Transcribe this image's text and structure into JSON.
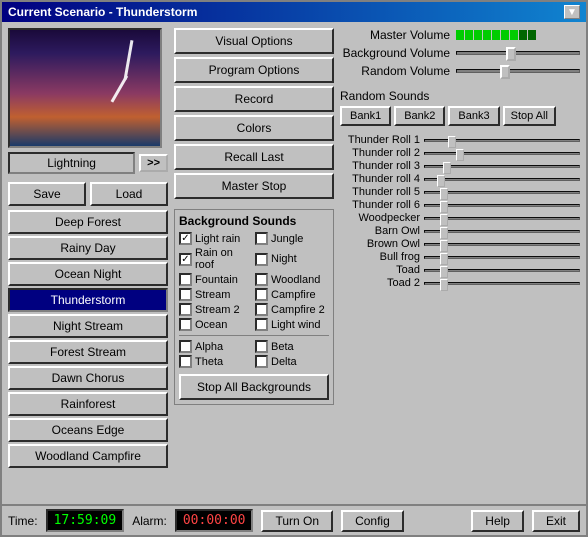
{
  "window": {
    "title": "Current Scenario - Thunderstorm",
    "minimize_btn": "▼"
  },
  "preview": {
    "label": "Lightning",
    "nav_btn": ">>"
  },
  "left_panel": {
    "save": "Save",
    "load": "Load",
    "scenarios": [
      {
        "label": "Deep Forest",
        "active": false
      },
      {
        "label": "Rainy Day",
        "active": false
      },
      {
        "label": "Ocean Night",
        "active": false
      },
      {
        "label": "Thunderstorm",
        "active": true
      },
      {
        "label": "Night Stream",
        "active": false
      },
      {
        "label": "Forest Stream",
        "active": false
      },
      {
        "label": "Dawn Chorus",
        "active": false
      },
      {
        "label": "Rainforest",
        "active": false
      },
      {
        "label": "Oceans Edge",
        "active": false
      },
      {
        "label": "Woodland Campfire",
        "active": false
      }
    ]
  },
  "main_buttons": [
    "Visual Options",
    "Program Options",
    "Record",
    "Colors",
    "Recall Last",
    "Master Stop"
  ],
  "background_sounds": {
    "title": "Background Sounds",
    "sounds": [
      {
        "label": "Light rain",
        "checked": true
      },
      {
        "label": "Jungle",
        "checked": false
      },
      {
        "label": "Rain on roof",
        "checked": true
      },
      {
        "label": "Night",
        "checked": false
      },
      {
        "label": "Fountain",
        "checked": false
      },
      {
        "label": "Woodland",
        "checked": false
      },
      {
        "label": "Stream",
        "checked": false
      },
      {
        "label": "Campfire",
        "checked": false
      },
      {
        "label": "Stream 2",
        "checked": false
      },
      {
        "label": "Campfire 2",
        "checked": false
      },
      {
        "label": "Ocean",
        "checked": false
      },
      {
        "label": "Light wind",
        "checked": false
      }
    ],
    "brain_waves": [
      {
        "label": "Alpha",
        "checked": false
      },
      {
        "label": "Beta",
        "checked": false
      },
      {
        "label": "Theta",
        "checked": false
      },
      {
        "label": "Delta",
        "checked": false
      }
    ],
    "stop_btn": "Stop All Backgrounds"
  },
  "right_panel": {
    "master_volume_label": "Master Volume",
    "background_volume_label": "Background Volume",
    "random_volume_label": "Random Volume",
    "random_sounds_label": "Random Sounds",
    "banks": [
      "Bank1",
      "Bank2",
      "Bank3"
    ],
    "stop_all": "Stop All",
    "sound_sliders": [
      {
        "label": "Thunder Roll 1",
        "pos": 15
      },
      {
        "label": "Thunder roll 2",
        "pos": 20
      },
      {
        "label": "Thunder roll 3",
        "pos": 12
      },
      {
        "label": "Thunder roll 4",
        "pos": 8
      },
      {
        "label": "Thunder roll 5",
        "pos": 10
      },
      {
        "label": "Thunder roll 6",
        "pos": 10
      },
      {
        "label": "Woodpecker",
        "pos": 10
      },
      {
        "label": "Barn Owl",
        "pos": 10
      },
      {
        "label": "Brown Owl",
        "pos": 10
      },
      {
        "label": "Bull frog",
        "pos": 10
      },
      {
        "label": "Toad",
        "pos": 10
      },
      {
        "label": "Toad 2",
        "pos": 10
      }
    ]
  },
  "status_bar": {
    "time_label": "Time:",
    "time_value": "17:59:09",
    "alarm_label": "Alarm:",
    "alarm_value": "00:00:00",
    "turn_on": "Turn On",
    "config": "Config",
    "help": "Help",
    "exit": "Exit"
  }
}
